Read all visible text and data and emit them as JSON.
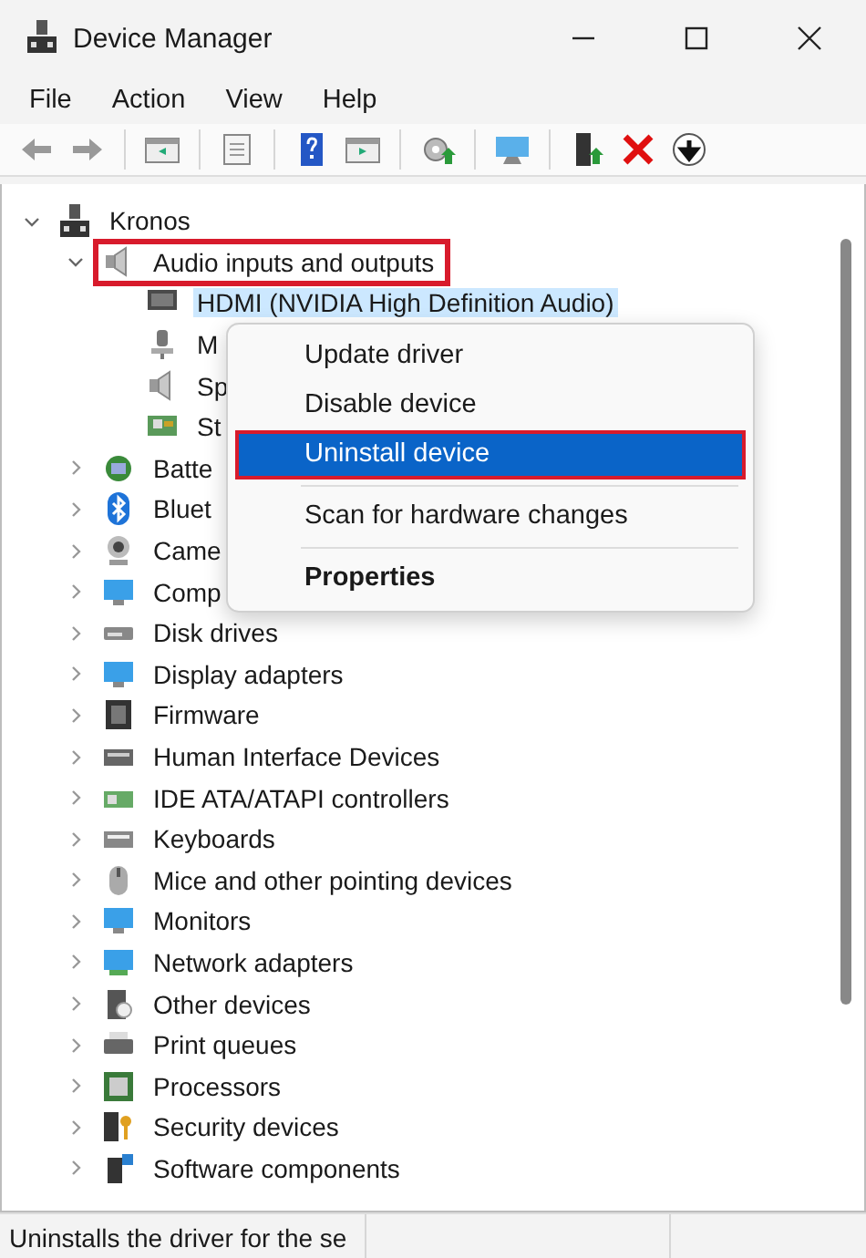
{
  "window": {
    "title": "Device Manager"
  },
  "menu_bar": [
    {
      "label": "File"
    },
    {
      "label": "Action"
    },
    {
      "label": "View"
    },
    {
      "label": "Help"
    }
  ],
  "tree": {
    "label": "Kronos",
    "expanded": true,
    "selected": false,
    "children": [
      {
        "label": "Audio inputs and outputs",
        "expanded": true,
        "selected": false,
        "callout": true,
        "children": [
          {
            "label": "HDMI (NVIDIA High Definition Audio)",
            "selected": true
          },
          {
            "label": "M",
            "selected": false
          },
          {
            "label": "Sp",
            "selected": false
          },
          {
            "label": "St",
            "selected": false
          }
        ]
      },
      {
        "label": "Batte",
        "expanded": false,
        "selected": false
      },
      {
        "label": "Bluet",
        "expanded": false,
        "selected": false
      },
      {
        "label": "Came",
        "expanded": false,
        "selected": false
      },
      {
        "label": "Comp",
        "expanded": false,
        "selected": false
      },
      {
        "label": "Disk drives",
        "expanded": false,
        "selected": false
      },
      {
        "label": "Display adapters",
        "expanded": false,
        "selected": false
      },
      {
        "label": "Firmware",
        "expanded": false,
        "selected": false
      },
      {
        "label": "Human Interface Devices",
        "expanded": false,
        "selected": false
      },
      {
        "label": "IDE ATA/ATAPI controllers",
        "expanded": false,
        "selected": false
      },
      {
        "label": "Keyboards",
        "expanded": false,
        "selected": false
      },
      {
        "label": "Mice and other pointing devices",
        "expanded": false,
        "selected": false
      },
      {
        "label": "Monitors",
        "expanded": false,
        "selected": false
      },
      {
        "label": "Network adapters",
        "expanded": false,
        "selected": false
      },
      {
        "label": "Other devices",
        "expanded": false,
        "selected": false
      },
      {
        "label": "Print queues",
        "expanded": false,
        "selected": false
      },
      {
        "label": "Processors",
        "expanded": false,
        "selected": false
      },
      {
        "label": "Security devices",
        "expanded": false,
        "selected": false
      },
      {
        "label": "Software components",
        "expanded": false,
        "selected": false
      }
    ]
  },
  "context_menu": [
    {
      "kind": "item",
      "label": "Update driver",
      "selected": false
    },
    {
      "kind": "item",
      "label": "Disable device",
      "selected": false
    },
    {
      "kind": "item",
      "label": "Uninstall device",
      "selected": true,
      "callout": true
    },
    {
      "kind": "separator"
    },
    {
      "kind": "item",
      "label": "Scan for hardware changes",
      "selected": false
    },
    {
      "kind": "separator"
    },
    {
      "kind": "bold",
      "label": "Properties",
      "selected": false
    }
  ],
  "status_bar": {
    "text": "Uninstalls the driver for the se"
  }
}
